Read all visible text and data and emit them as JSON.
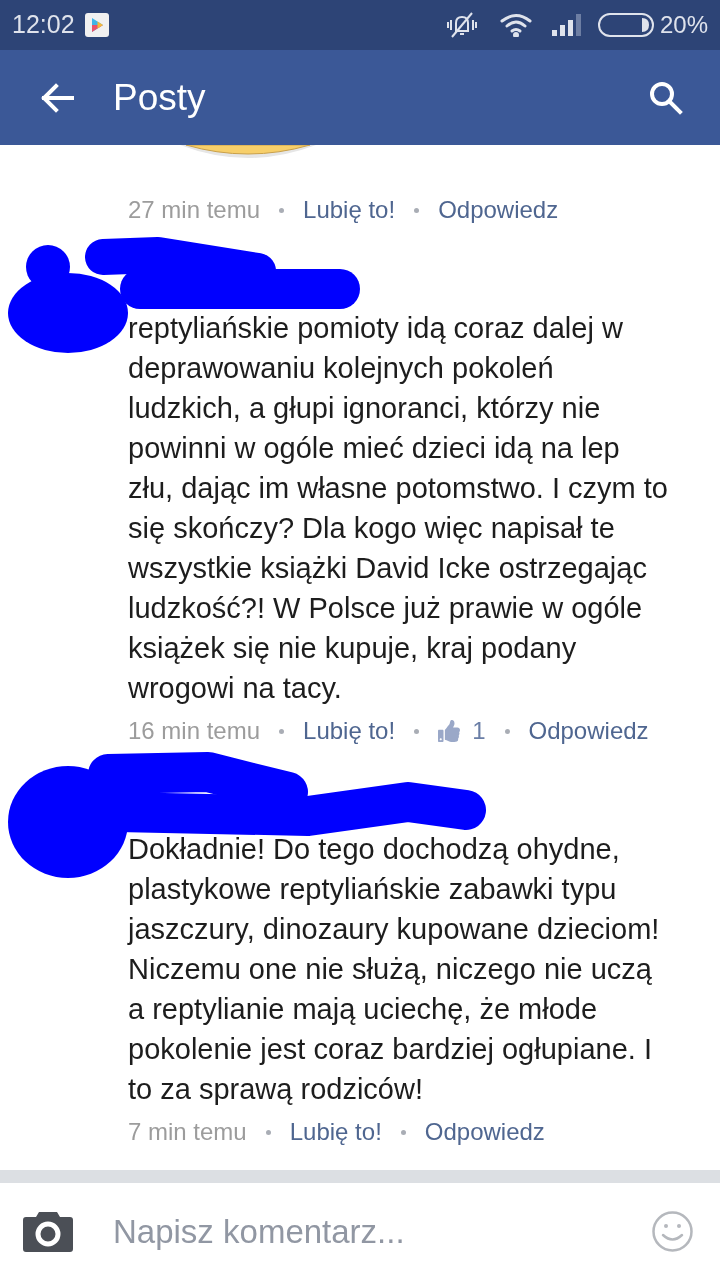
{
  "status_bar": {
    "time": "12:02",
    "battery": "20%"
  },
  "header": {
    "title": "Posty"
  },
  "comments": [
    {
      "kind": "sticker",
      "time": "27 min temu",
      "like": "Lubię to!",
      "reply": "Odpowiedz"
    },
    {
      "kind": "text",
      "redacted": true,
      "text": "reptyliańskie pomioty idą coraz dalej w deprawowaniu kolejnych pokoleń ludzkich, a głupi ignoranci, którzy nie powinni w ogóle mieć dzieci idą na lep złu, dając im własne potomstwo. I czym to się skończy? Dla kogo więc napisał te wszystkie książki David Icke ostrzegając ludzkość?! W Polsce już prawie w ogóle książek się nie kupuje, kraj podany wrogowi na tacy.",
      "time": "16 min temu",
      "like": "Lubię to!",
      "like_count": "1",
      "reply": "Odpowiedz"
    },
    {
      "kind": "text",
      "redacted": true,
      "text": "Dokładnie! Do tego dochodzą ohydne, plastykowe reptyliańskie zabawki typu jaszczury, dinozaury kupowane dzieciom! Niczemu one nie służą, niczego nie uczą a reptylianie mają uciechę, że młode pokolenie jest coraz bardziej ogłupiane. I to za sprawą rodziców!",
      "time": "7 min temu",
      "like": "Lubię to!",
      "reply": "Odpowiedz"
    }
  ],
  "composer": {
    "placeholder": "Napisz komentarz..."
  }
}
